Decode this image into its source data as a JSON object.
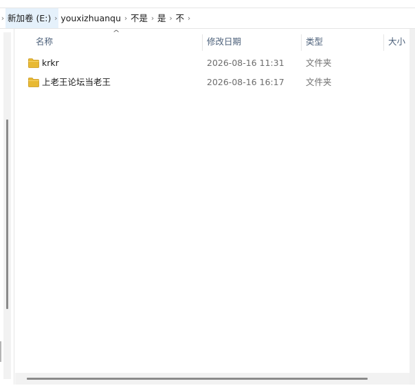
{
  "breadcrumb": {
    "items": [
      {
        "label": "新加卷 (E:)"
      },
      {
        "label": "youxizhuanqu"
      },
      {
        "label": "不是"
      },
      {
        "label": "是"
      },
      {
        "label": "不"
      }
    ]
  },
  "columns": {
    "name": "名称",
    "date": "修改日期",
    "type": "类型",
    "size": "大小"
  },
  "sort": {
    "column": "name",
    "direction": "ascending"
  },
  "files": [
    {
      "name": "krkr",
      "modified": "2026-08-16 11:31",
      "type": "文件夹",
      "icon": "folder-icon"
    },
    {
      "name": "上老王论坛当老王",
      "modified": "2026-08-16 16:17",
      "type": "文件夹",
      "icon": "folder-icon"
    }
  ],
  "colors": {
    "folder": "#e8b933",
    "selection": "#e5f1fb",
    "header_text": "#4c607a"
  }
}
